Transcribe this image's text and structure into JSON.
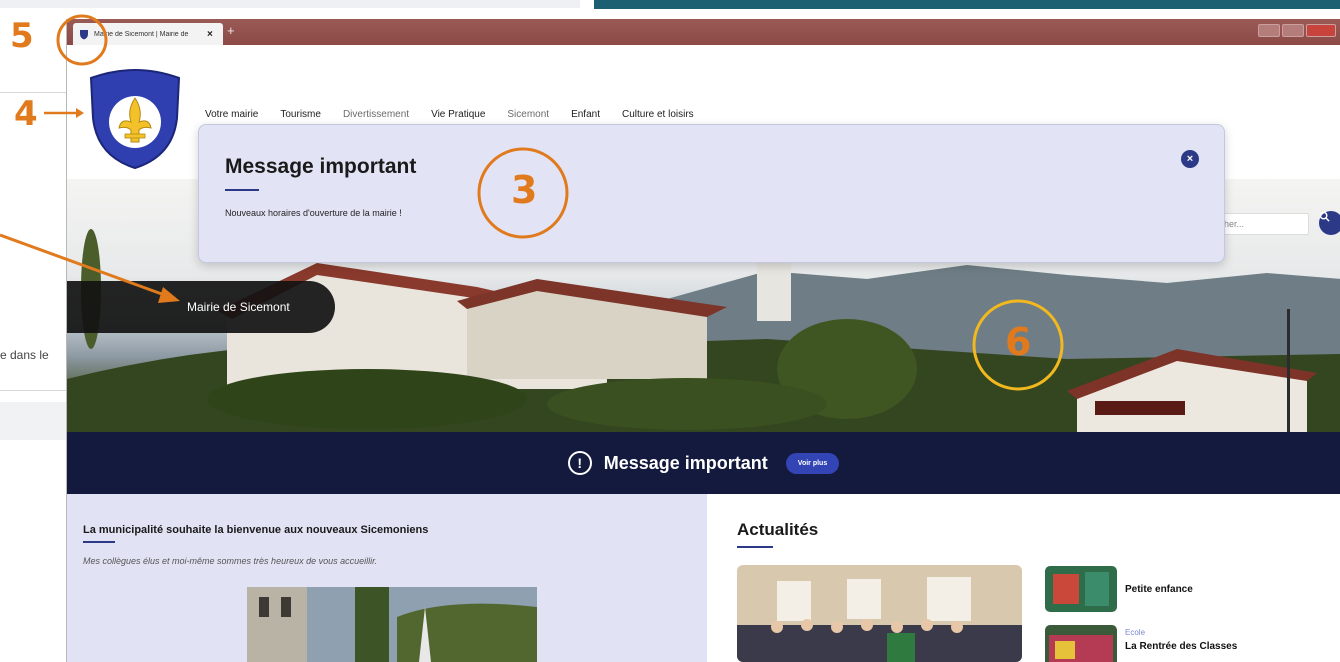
{
  "colors": {
    "accent_orange": "#e07a1c",
    "accent_yellow": "#f2b81f",
    "navy": "#141a3e",
    "brand_blue": "#2b3987",
    "panel_lavender": "#e1e3f5"
  },
  "annotations": {
    "label_5": "5",
    "label_4": "4",
    "label_3": "3",
    "label_6": "6"
  },
  "background_page": {
    "fragment_text": "e dans le"
  },
  "browser": {
    "tab_title": "Mairie de Sicemont | Mairie de",
    "tab_close": "×",
    "new_tab": "+"
  },
  "site": {
    "nav": [
      {
        "label": "Votre mairie"
      },
      {
        "label": "Tourisme"
      },
      {
        "label": "Divertissement"
      },
      {
        "label": "Vie Pratique"
      },
      {
        "label": "Sicemont"
      },
      {
        "label": "Enfant"
      },
      {
        "label": "Culture et loisirs"
      }
    ],
    "hero_label": "Mairie de Sicemont",
    "search_placeholder": "her...",
    "search_icon": "search-icon"
  },
  "modal": {
    "title": "Message important",
    "body": "Nouveaux horaires d'ouverture de la mairie !",
    "close_label": "×"
  },
  "alert_bar": {
    "icon_glyph": "!",
    "title": "Message important",
    "button_label": "Voir plus"
  },
  "welcome": {
    "title": "La municipalité souhaite la bienvenue aux nouveaux Sicemoniens",
    "subtitle": "Mes collègues élus et moi-même sommes très heureux de vous accueillir."
  },
  "news": {
    "title": "Actualités",
    "items": [
      {
        "category": "",
        "title": "Petite enfance"
      },
      {
        "category": "Ecole",
        "title": "La Rentrée des Classes"
      }
    ]
  }
}
